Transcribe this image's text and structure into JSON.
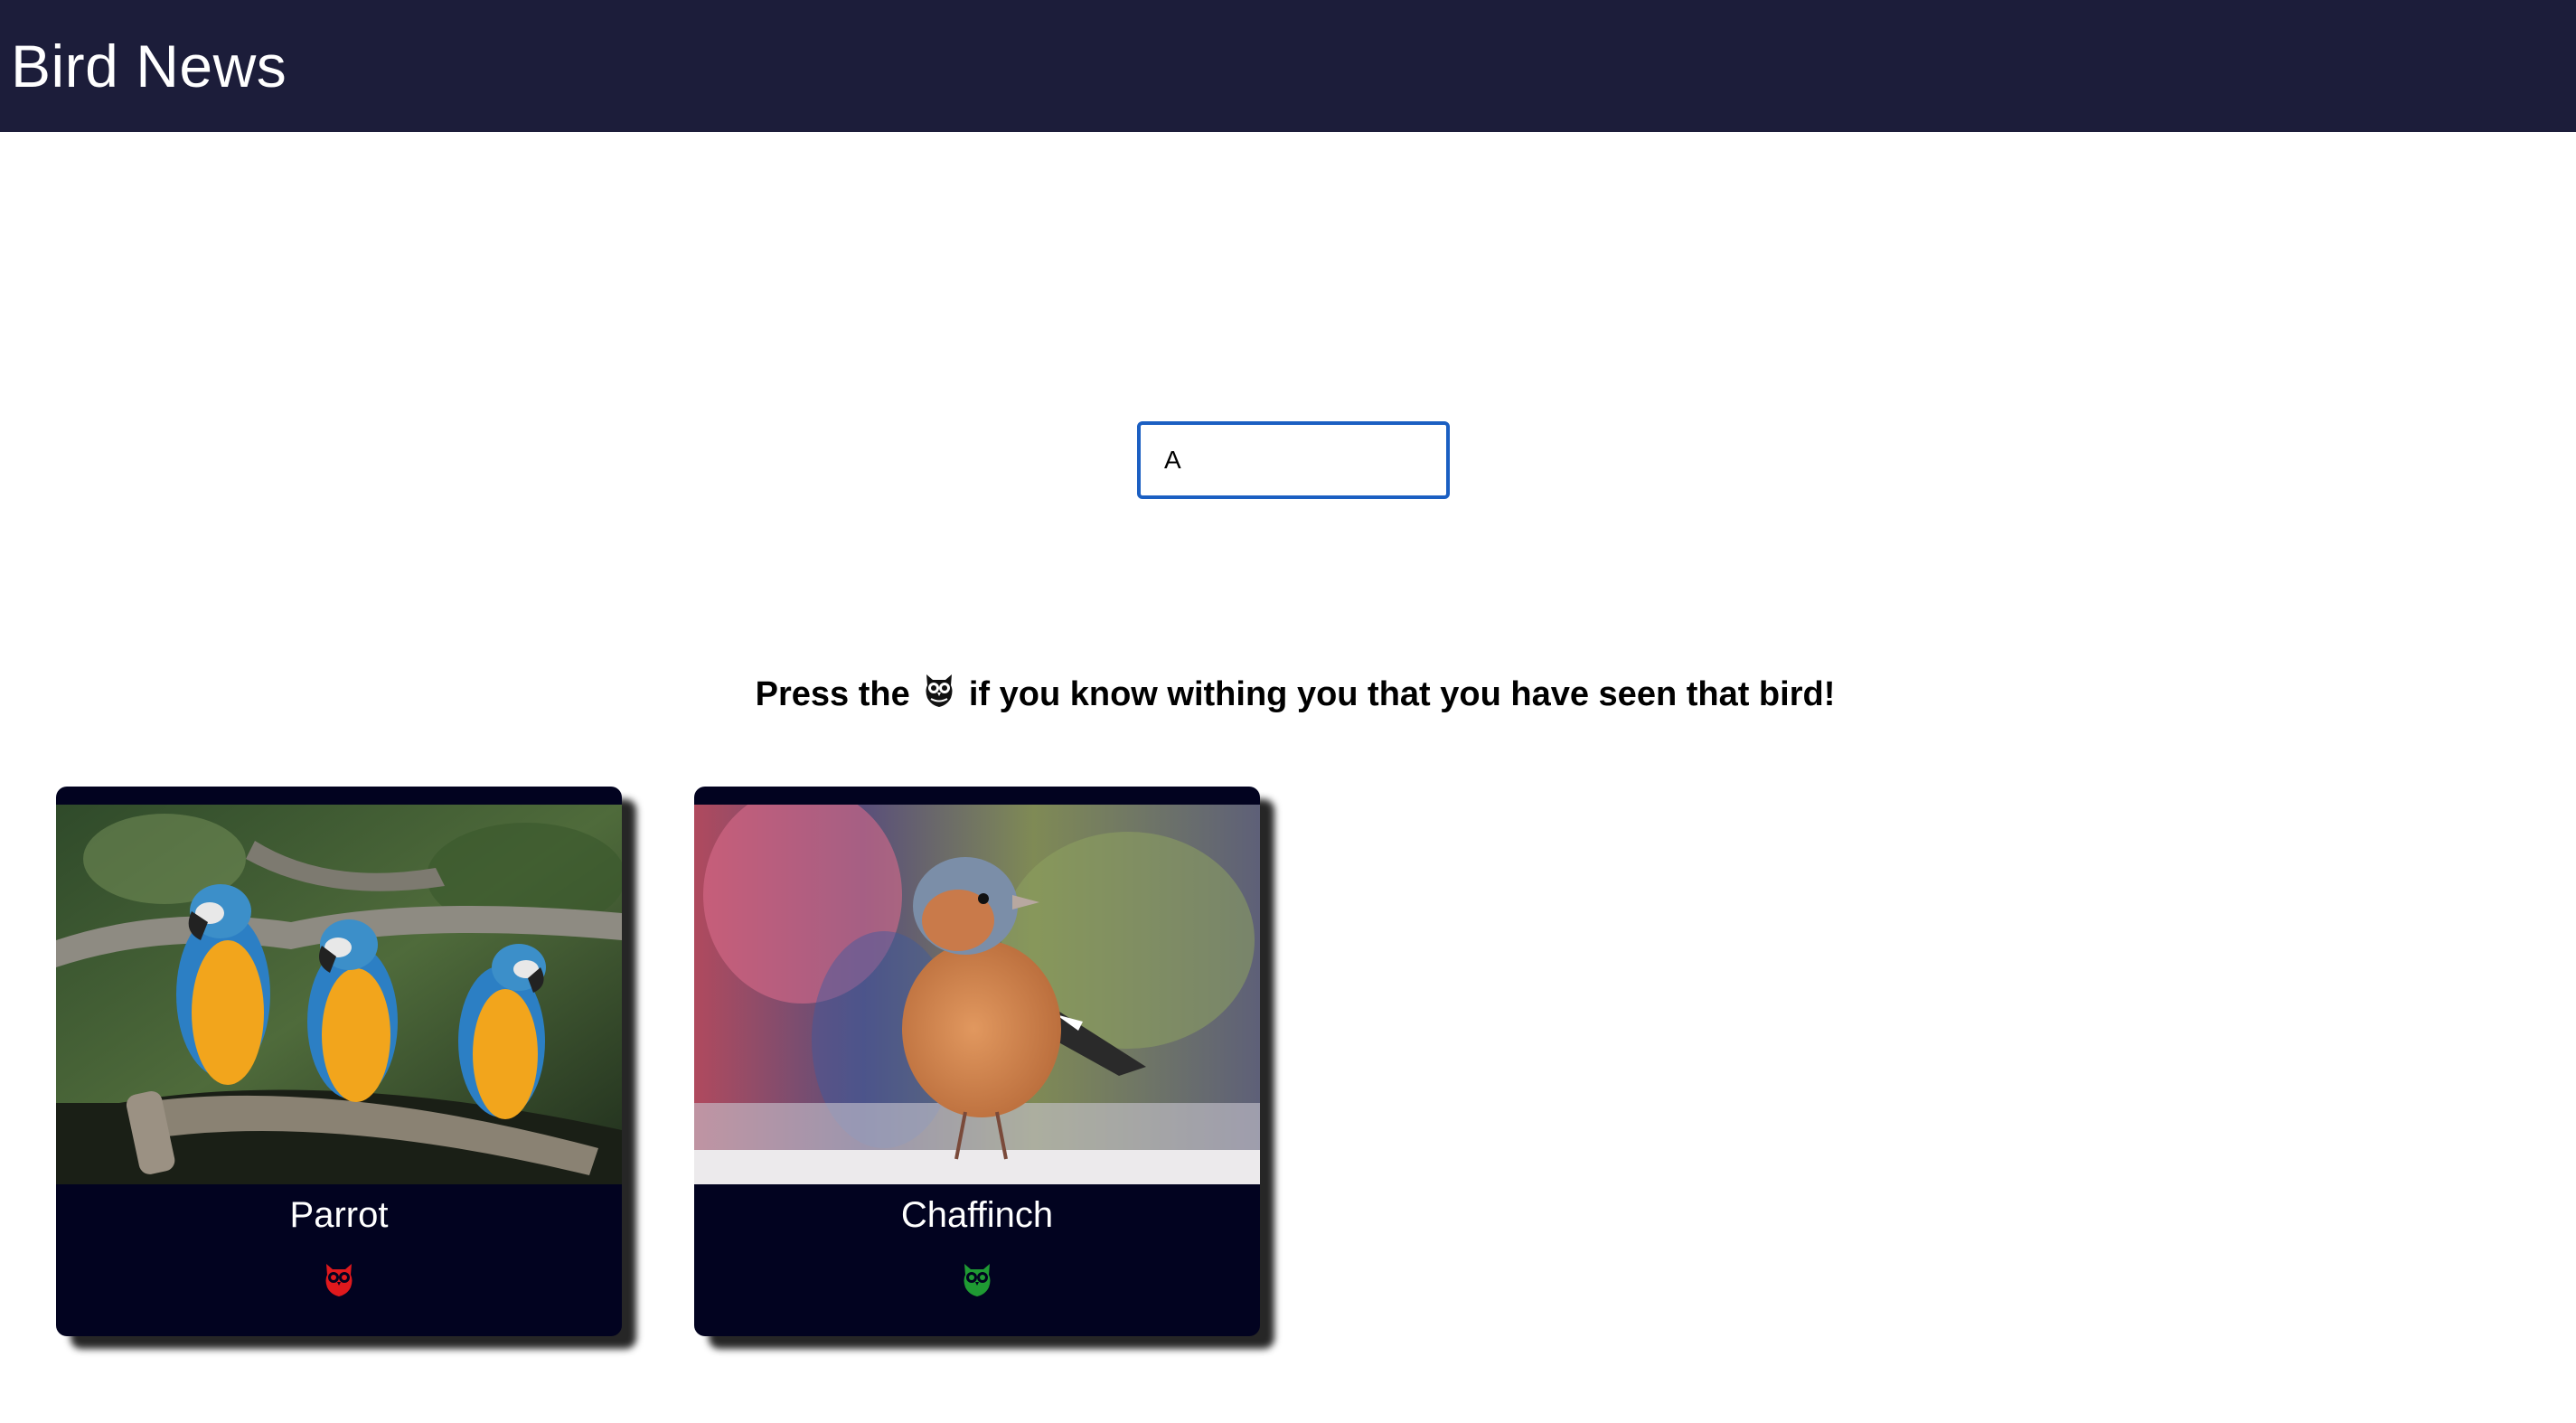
{
  "header": {
    "title": "Bird News"
  },
  "search": {
    "value": "A",
    "placeholder": ""
  },
  "instruction": {
    "prefix": "Press the",
    "suffix": "if you know withing you that you have seen that bird!",
    "icon": "owl-icon"
  },
  "cards": [
    {
      "name": "Parrot",
      "image": "parrots-on-branch",
      "icon": "owl-icon",
      "seen_color": "#e0191d"
    },
    {
      "name": "Chaffinch",
      "image": "chaffinch-photo",
      "icon": "owl-icon",
      "seen_color": "#1f9a33"
    }
  ],
  "colors": {
    "header_bg": "#1c1d3a",
    "card_bg": "#020320",
    "input_border": "#1b5fc2"
  }
}
